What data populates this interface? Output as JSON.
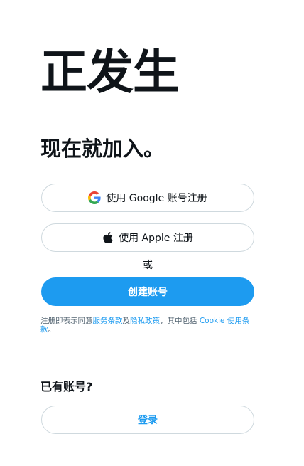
{
  "brand": {
    "title": "正发生"
  },
  "signup": {
    "heading": "现在就加入。",
    "google_label": "使用 Google 账号注册",
    "apple_label": "使用 Apple 注册",
    "or_text": "或",
    "create_label": "创建账号",
    "terms": {
      "prefix": "注册即表示同意",
      "terms_link": "服务条款",
      "and": "及",
      "privacy_link": "隐私政策",
      "middle": "，其中包括 ",
      "cookie_link": "Cookie 使用条款",
      "suffix": "。"
    }
  },
  "login": {
    "prompt": "已有账号?",
    "button_label": "登录"
  },
  "colors": {
    "accent": "#1d9bf0",
    "text": "#0f1419",
    "border": "#cfd9de",
    "muted": "#536471"
  },
  "icons": {
    "google": "google-icon",
    "apple": "apple-icon"
  }
}
